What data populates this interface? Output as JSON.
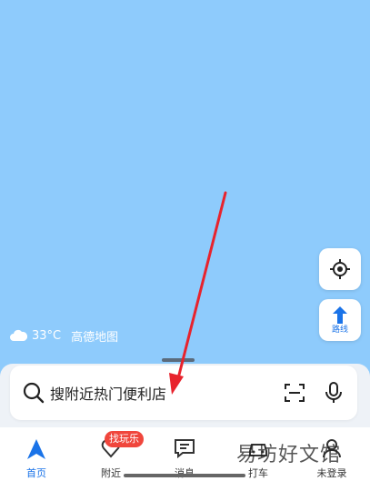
{
  "map": {
    "weather_temp": "33°C",
    "brand": "高德地图",
    "route_button_label": "路线"
  },
  "search": {
    "placeholder": "搜附近热门便利店"
  },
  "nearby_badge": "找玩乐",
  "tabs": [
    {
      "label": "首页",
      "icon": "navigation-arrow-icon",
      "active": true
    },
    {
      "label": "附近",
      "icon": "heart-location-icon",
      "active": false
    },
    {
      "label": "消息",
      "icon": "message-icon",
      "active": false
    },
    {
      "label": "打车",
      "icon": "taxi-icon",
      "active": false
    },
    {
      "label": "未登录",
      "icon": "user-icon",
      "active": false
    }
  ],
  "watermark": "易坊好文馆",
  "colors": {
    "map_background": "#8ecbfc",
    "accent": "#1a73e8",
    "badge": "#f0463c",
    "annotation_arrow": "#e8232d"
  }
}
